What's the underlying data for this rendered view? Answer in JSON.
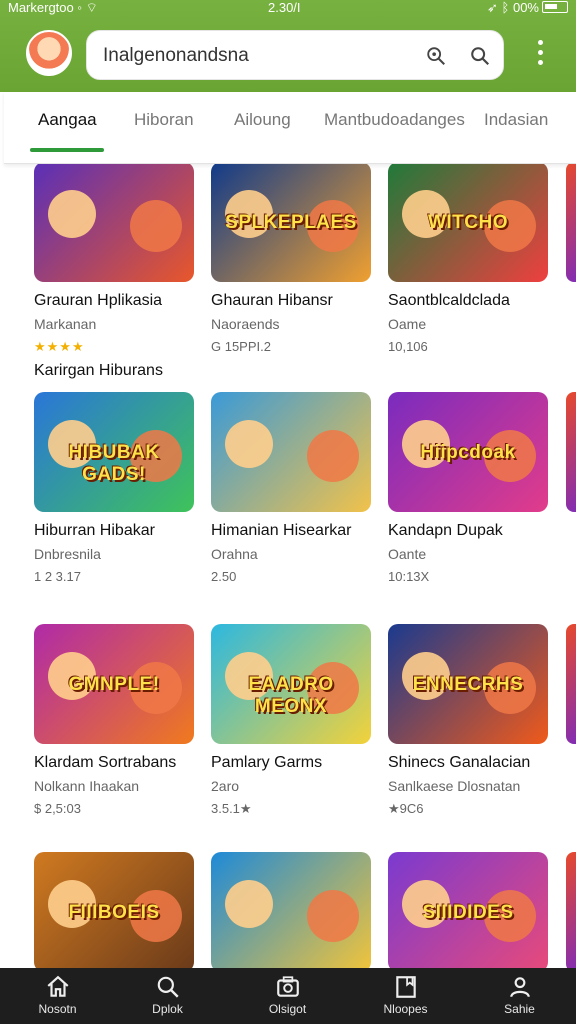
{
  "status_bar": {
    "left": "Markergtoo",
    "time": "2.30/I",
    "right": "00%"
  },
  "search": {
    "value": "Inalgenonandsna"
  },
  "tabs": [
    {
      "label": "Aangaa",
      "active": true
    },
    {
      "label": "Hiboran",
      "active": false
    },
    {
      "label": "Ailoung",
      "active": false
    },
    {
      "label": "Mantbudoadanges",
      "active": false
    },
    {
      "label": "Indasian",
      "active": false
    }
  ],
  "sections": [
    {
      "title": "",
      "cards": [
        {
          "art": "",
          "title": "Grauran Hplikasia",
          "subtitle": "Markanan",
          "meta": "★★★★",
          "colors": [
            "#5a2fb8",
            "#e8572a"
          ]
        },
        {
          "art": "SPLKEPLAES",
          "title": "Ghauran Hibansr",
          "subtitle": "Naoraends",
          "meta": "G 15PPI.2",
          "colors": [
            "#103a8a",
            "#f0a030"
          ]
        },
        {
          "art": "WITCHO",
          "title": "Saontblcaldclada",
          "subtitle": "Oame",
          "meta": "10,106",
          "colors": [
            "#1f7a3a",
            "#ef3f3f"
          ]
        }
      ]
    },
    {
      "title": "Karirgan Hiburans",
      "cards": [
        {
          "art": "HIBUBAK GADS!",
          "title": "Hiburran Hibakar",
          "subtitle": "Dnbresnila",
          "meta": "1 2 3.17",
          "colors": [
            "#2a76d8",
            "#3fc35a"
          ]
        },
        {
          "art": "",
          "title": "Himanian Hisearkar",
          "subtitle": "Orahna",
          "meta": "2.50",
          "colors": [
            "#3a9ad8",
            "#f2c24a"
          ]
        },
        {
          "art": "Hiipcdoak",
          "title": "Kandapn Dupak",
          "subtitle": "Oante",
          "meta": "10:13X",
          "colors": [
            "#7a2bbf",
            "#e23c8a"
          ]
        }
      ]
    },
    {
      "title": "",
      "cards": [
        {
          "art": "GMNPLE!",
          "title": "Klardam Sortrabans",
          "subtitle": "Nolkann Ihaakan",
          "meta": "$ 2,5:03",
          "colors": [
            "#b02aa8",
            "#f07a1e"
          ]
        },
        {
          "art": "EAADRO MEONX",
          "title": "Pamlary Garms",
          "subtitle": "2aro",
          "meta": "3.5.1★",
          "colors": [
            "#2cb8e0",
            "#f3d23a"
          ]
        },
        {
          "art": "ENNECRHS",
          "title": "Shinecs Ganalacian",
          "subtitle": "Sanlkaese Dlosnatan",
          "meta": "★9C6",
          "colors": [
            "#1a3a8f",
            "#f05a1a"
          ]
        }
      ]
    },
    {
      "title": "",
      "cards": [
        {
          "art": "FIIIBOEIS",
          "title": "",
          "subtitle": "",
          "meta": "",
          "colors": [
            "#d07a20",
            "#6a3a1a"
          ]
        },
        {
          "art": "",
          "title": "",
          "subtitle": "",
          "meta": "",
          "colors": [
            "#1e8ad8",
            "#f2c43a"
          ]
        },
        {
          "art": "SIIIDIDES",
          "title": "",
          "subtitle": "",
          "meta": "",
          "colors": [
            "#7a3ad0",
            "#e84a7a"
          ]
        }
      ]
    }
  ],
  "bottom_nav": [
    {
      "label": "Nosotn",
      "icon": "home-icon"
    },
    {
      "label": "Dplok",
      "icon": "search-icon"
    },
    {
      "label": "Olsigot",
      "icon": "camera-icon"
    },
    {
      "label": "Nloopes",
      "icon": "bookmark-icon"
    },
    {
      "label": "Sahie",
      "icon": "person-icon"
    }
  ],
  "colors": {
    "header_green": "#6fab3a",
    "tab_underline": "#2e9a3a",
    "nav_bg": "#1e1e1e"
  }
}
